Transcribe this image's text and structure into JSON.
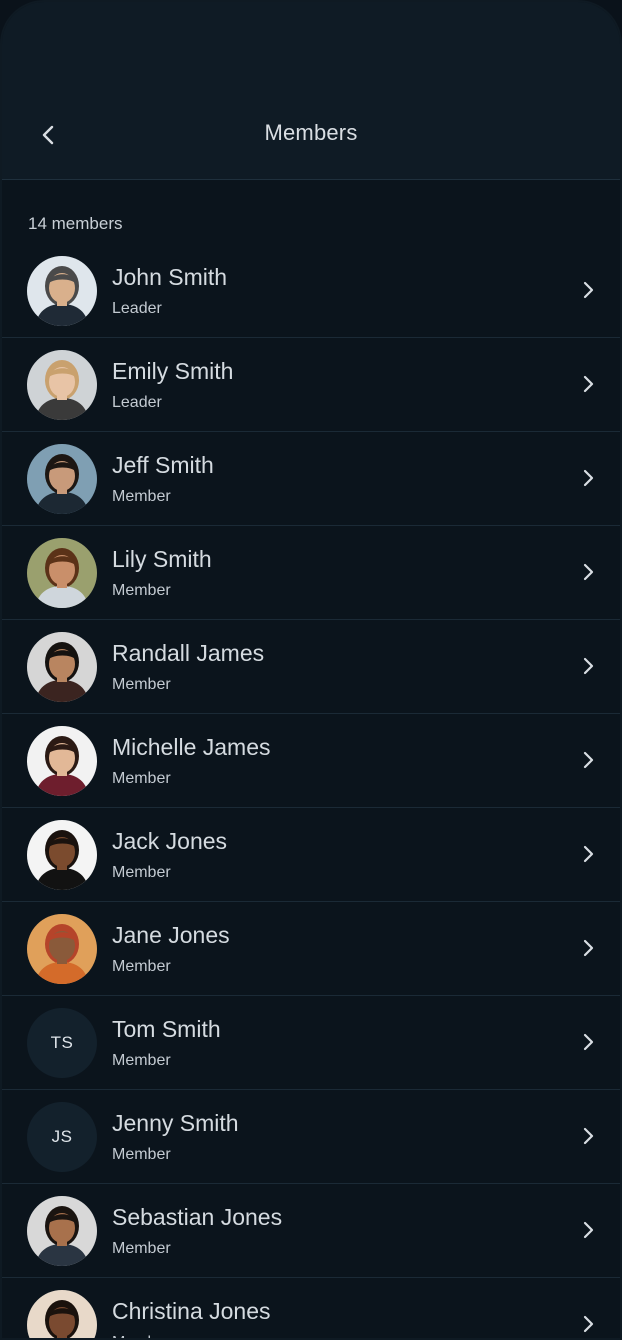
{
  "header": {
    "title": "Members",
    "back_icon": "chevron-left-icon"
  },
  "summary": {
    "count_label": "14 members"
  },
  "members": [
    {
      "name": "John Smith",
      "role": "Leader",
      "initials": "",
      "photo": true,
      "skin": "#d9b08c",
      "hair": "#4a4a4a",
      "shirt": "#1f2a36",
      "bg": "#dfe6ec"
    },
    {
      "name": "Emily Smith",
      "role": "Leader",
      "initials": "",
      "photo": true,
      "skin": "#e8c4a6",
      "hair": "#c9a16e",
      "shirt": "#3a3a3a",
      "bg": "#cfd3d6"
    },
    {
      "name": "Jeff Smith",
      "role": "Member",
      "initials": "",
      "photo": true,
      "skin": "#c89a7a",
      "hair": "#1d1713",
      "shirt": "#1c2833",
      "bg": "#7f9fb3"
    },
    {
      "name": "Lily Smith",
      "role": "Member",
      "initials": "",
      "photo": true,
      "skin": "#c98f6a",
      "hair": "#5b3218",
      "shirt": "#cfd6dc",
      "bg": "#9aa06e"
    },
    {
      "name": "Randall James",
      "role": "Member",
      "initials": "",
      "photo": true,
      "skin": "#b98560",
      "hair": "#151210",
      "shirt": "#3b2420",
      "bg": "#d6d6d6"
    },
    {
      "name": "Michelle James",
      "role": "Member",
      "initials": "",
      "photo": true,
      "skin": "#e2b897",
      "hair": "#2b1a14",
      "shirt": "#6e1e2d",
      "bg": "#f2f2f2"
    },
    {
      "name": "Jack Jones",
      "role": "Member",
      "initials": "",
      "photo": true,
      "skin": "#7b4b2e",
      "hair": "#1a120e",
      "shirt": "#121212",
      "bg": "#f4f4f4"
    },
    {
      "name": "Jane Jones",
      "role": "Member",
      "initials": "",
      "photo": true,
      "skin": "#8a5a3a",
      "hair": "#b5442a",
      "shirt": "#d46b2a",
      "bg": "#e0a05a"
    },
    {
      "name": "Tom Smith",
      "role": "Member",
      "initials": "TS",
      "photo": false
    },
    {
      "name": "Jenny Smith",
      "role": "Member",
      "initials": "JS",
      "photo": false
    },
    {
      "name": "Sebastian Jones",
      "role": "Member",
      "initials": "",
      "photo": true,
      "skin": "#a8714c",
      "hair": "#1a1410",
      "shirt": "#2a3542",
      "bg": "#d8d8d8"
    },
    {
      "name": "Christina Jones",
      "role": "Member",
      "initials": "",
      "photo": true,
      "skin": "#7a4a30",
      "hair": "#1a120d",
      "shirt": "#e0d0c0",
      "bg": "#e8d9c9"
    }
  ],
  "colors": {
    "background": "#0b141c",
    "header": "#0f1b25",
    "divider": "#1b2a36",
    "text": "#d5dbe0"
  }
}
